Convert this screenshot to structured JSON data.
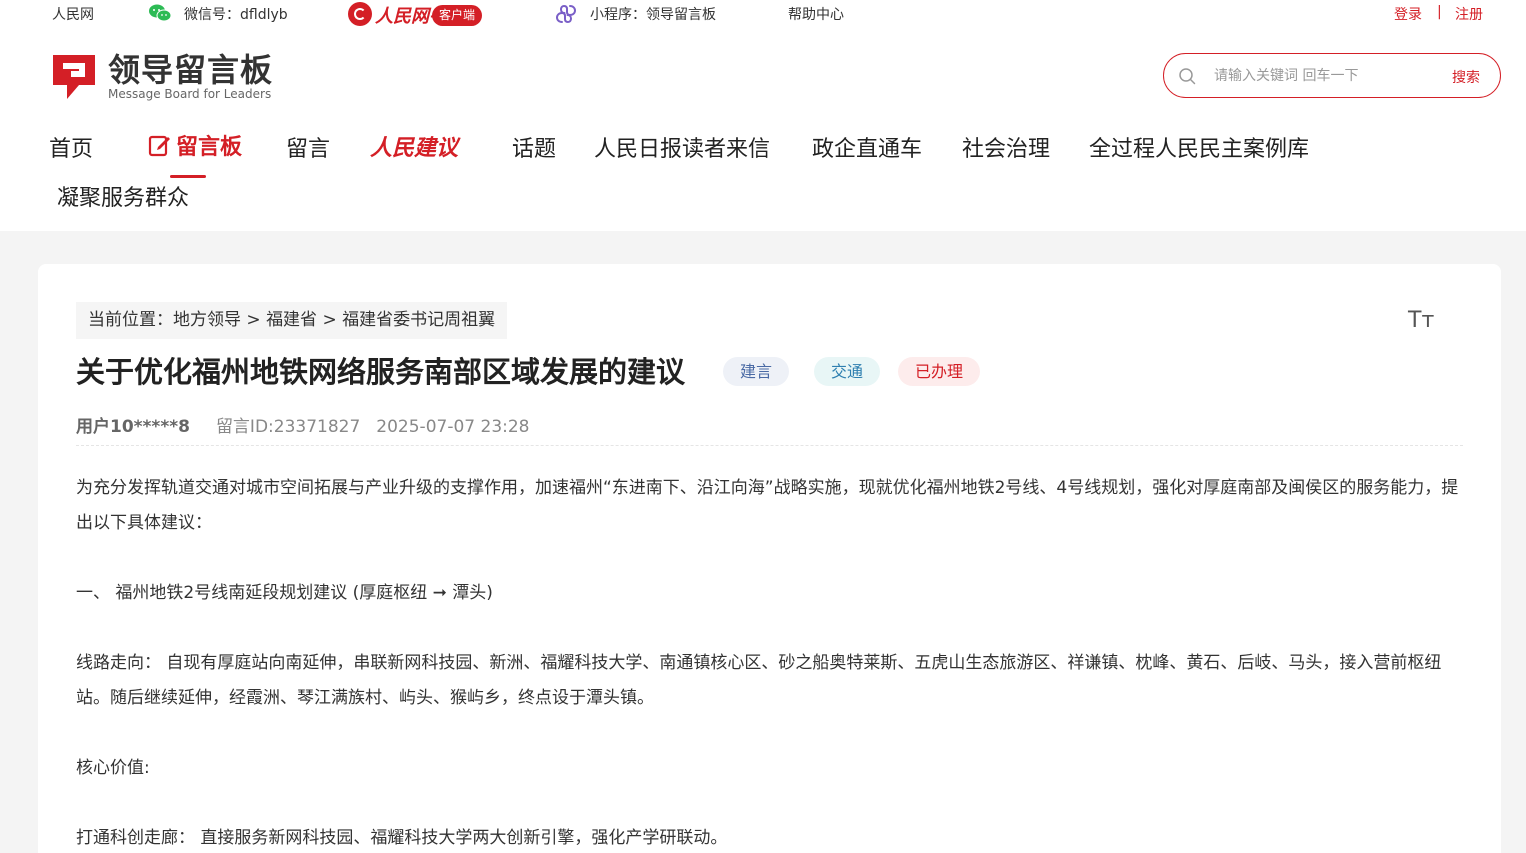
{
  "topbar": {
    "site": "人民网",
    "wechat": "微信号：dfldlyb",
    "rmw_text": "人民网+",
    "rmw_badge": "客户端",
    "mini_program": "小程序：领导留言板",
    "help": "帮助中心",
    "login": "登录",
    "separator": "|",
    "register": "注册"
  },
  "logo": {
    "title": "领导留言板",
    "subtitle": "Message Board for Leaders"
  },
  "search": {
    "placeholder": "请输入关键词 回车一下",
    "button": "搜索"
  },
  "nav": {
    "items": [
      "首页",
      "留言板",
      "留言",
      "人民建议",
      "话题",
      "人民日报读者来信",
      "政企直通车",
      "社会治理",
      "全过程人民民主案例库",
      "凝聚服务群众"
    ]
  },
  "article": {
    "breadcrumb": [
      "当前位置：",
      "地方领导",
      ">",
      "福建省",
      ">",
      "福建省委书记周祖翼"
    ],
    "font_toggle": "Tт",
    "title": "关于优化福州地铁网络服务南部区域发展的建议",
    "tags": [
      "建言",
      "交通",
      "已办理"
    ],
    "user": "用户10*****8",
    "message_id": "留言ID:23371827",
    "datetime": "2025-07-07 23:28",
    "paragraphs": [
      "为充分发挥轨道交通对城市空间拓展与产业升级的支撑作用，加速福州“东进南下、沿江向海”战略实施，现就优化福州地铁2号线、4号线规划，强化对厚庭南部及闽侯区的服务能力，提出以下具体建议：",
      "",
      "一、 福州地铁2号线南延段规划建议 (厚庭枢纽 ➞ 潭头)",
      "",
      "线路走向： 自现有厚庭站向南延伸，串联新网科技园、新洲、福耀科技大学、南通镇核心区、砂之船奥特莱斯、五虎山生态旅游区、祥谦镇、枕峰、黄石、后岐、马头，接入营前枢纽站。随后继续延伸，经霞洲、琴江满族村、屿头、猴屿乡，终点设于潭头镇。",
      "",
      "核心价值:",
      "",
      "打通科创走廊： 直接服务新网科技园、福耀科技大学两大创新引擎，强化产学研联动。"
    ]
  },
  "colors": {
    "brand_red": "#d41f26"
  }
}
